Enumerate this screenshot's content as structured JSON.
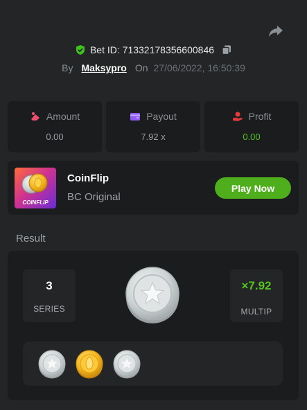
{
  "header": {
    "share_icon": "share-icon",
    "bet_id_label": "Bet ID: 71332178356600846",
    "verified_icon": "shield-check-icon",
    "copy_icon": "copy-icon",
    "by_label": "By",
    "username": "Maksypro",
    "on_label": "On",
    "datetime": "27/06/2022, 16:50:39"
  },
  "stats": {
    "amount": {
      "label": "Amount",
      "value": "0.00",
      "icon": "coins-icon"
    },
    "payout": {
      "label": "Payout",
      "value": "7.92 x",
      "icon": "wallet-icon"
    },
    "profit": {
      "label": "Profit",
      "value": "0.00",
      "icon": "profit-hand-icon"
    }
  },
  "game": {
    "thumb_text": "COINFLIP",
    "name": "CoinFlip",
    "provider": "BC Original",
    "play_label": "Play Now"
  },
  "result": {
    "label": "Result",
    "series_value": "3",
    "series_label": "SERIES",
    "multiplier_value": "×7.92",
    "multiplier_label": "MULTIP",
    "main_coin": "silver",
    "history": [
      "silver",
      "gold",
      "silver"
    ]
  },
  "colors": {
    "background": "#232526",
    "card": "#1b1c1d",
    "accent_green": "#55c51e",
    "play_button": "#4fae1c",
    "amount_icon": "#ec4f6e",
    "payout_icon": "#8f5cf7",
    "profit_icon": "#e23b3b"
  }
}
